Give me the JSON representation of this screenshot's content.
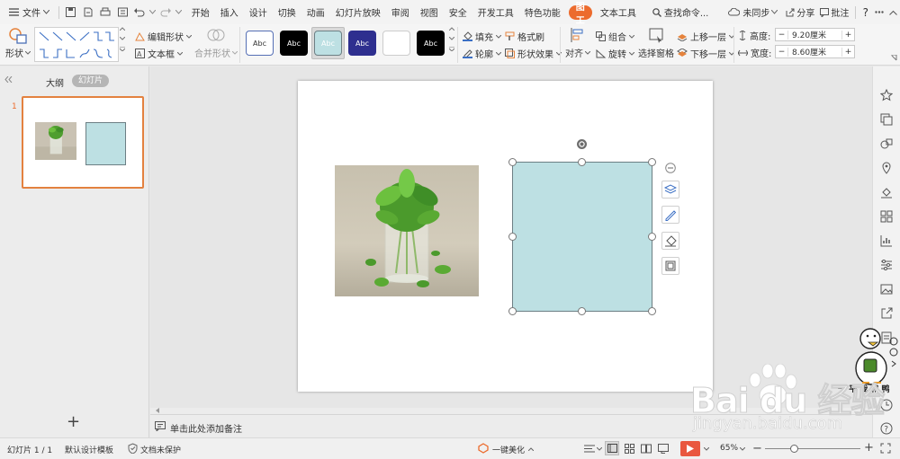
{
  "menu": {
    "file": "文件",
    "tabs": [
      "开始",
      "插入",
      "设计",
      "切换",
      "动画",
      "幻灯片放映",
      "审阅",
      "视图",
      "安全",
      "开发工具",
      "特色功能"
    ],
    "active_tab": "绘图工具",
    "text_tool": "文本工具",
    "search": "查找命令...",
    "sync": "未同步",
    "share": "分享",
    "comment": "批注",
    "help": "?"
  },
  "ribbon": {
    "shape": "形状",
    "edit_shape": "编辑形状",
    "textbox": "文本框",
    "merge_shape": "合并形状",
    "style_samples": [
      "Abc",
      "Abc",
      "Abc",
      "Abc",
      "Abc",
      "Abc"
    ],
    "fill": "填充",
    "format_painter": "格式刷",
    "outline": "轮廓",
    "shape_effects": "形状效果",
    "align": "对齐",
    "group": "组合",
    "rotate": "旋转",
    "selection_pane": "选择窗格",
    "bring_forward": "上移一层",
    "send_backward": "下移一层",
    "height_label": "高度:",
    "height_value": "9.20厘米",
    "width_label": "宽度:",
    "width_value": "8.60厘米"
  },
  "left_panel": {
    "tab_outline": "大纲",
    "tab_slides": "幻灯片",
    "slide_number": "1",
    "add_slide": "+"
  },
  "notes": {
    "placeholder": "单击此处添加备注"
  },
  "status": {
    "slide_info": "幻灯片 1 / 1",
    "template": "默认设计模板",
    "protection": "文档未保护",
    "beautify": "一键美化",
    "zoom": "65%"
  },
  "watermark": {
    "brand": "Bai du 经验",
    "url": "jingyan.baidu.com",
    "sticker_text": "一 平 我 和 鸭"
  },
  "colors": {
    "accent": "#ec6b2d",
    "shape_fill": "#bde0e3",
    "shape_stroke": "#6c7f84",
    "slideshow_red": "#e9573f"
  }
}
